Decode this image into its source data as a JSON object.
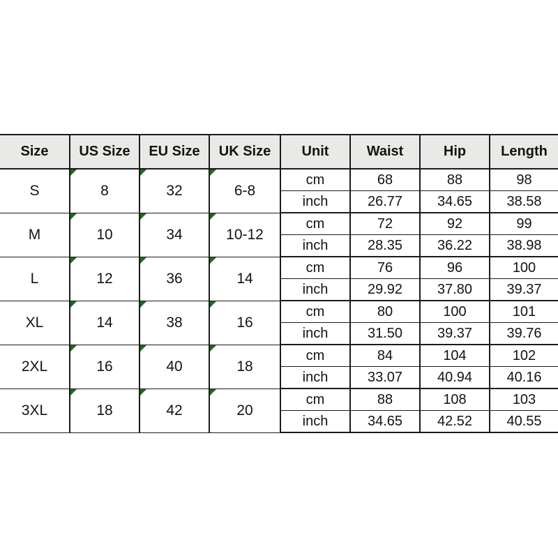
{
  "table": {
    "name": "size-chart",
    "headers": [
      "Size",
      "US Size",
      "EU Size",
      "UK Size",
      "Unit",
      "Waist",
      "Hip",
      "Length"
    ],
    "units": [
      "cm",
      "inch"
    ],
    "marker_icon": "green-corner-triangle-icon",
    "colors": {
      "header_background": "#e9e9e7",
      "cell_background": "#ffffff",
      "border": "#1a1a1a",
      "text": "#16120f",
      "marker": "#1b6b24"
    },
    "rows": [
      {
        "size": "S",
        "us_size": "8",
        "eu_size": "32",
        "uk_size": "6-8",
        "cm": {
          "unit": "cm",
          "waist": "68",
          "hip": "88",
          "length": "98"
        },
        "inch": {
          "unit": "inch",
          "waist": "26.77",
          "hip": "34.65",
          "length": "38.58"
        }
      },
      {
        "size": "M",
        "us_size": "10",
        "eu_size": "34",
        "uk_size": "10-12",
        "cm": {
          "unit": "cm",
          "waist": "72",
          "hip": "92",
          "length": "99"
        },
        "inch": {
          "unit": "inch",
          "waist": "28.35",
          "hip": "36.22",
          "length": "38.98"
        }
      },
      {
        "size": "L",
        "us_size": "12",
        "eu_size": "36",
        "uk_size": "14",
        "cm": {
          "unit": "cm",
          "waist": "76",
          "hip": "96",
          "length": "100"
        },
        "inch": {
          "unit": "inch",
          "waist": "29.92",
          "hip": "37.80",
          "length": "39.37"
        }
      },
      {
        "size": "XL",
        "us_size": "14",
        "eu_size": "38",
        "uk_size": "16",
        "cm": {
          "unit": "cm",
          "waist": "80",
          "hip": "100",
          "length": "101"
        },
        "inch": {
          "unit": "inch",
          "waist": "31.50",
          "hip": "39.37",
          "length": "39.76"
        }
      },
      {
        "size": "2XL",
        "us_size": "16",
        "eu_size": "40",
        "uk_size": "18",
        "cm": {
          "unit": "cm",
          "waist": "84",
          "hip": "104",
          "length": "102"
        },
        "inch": {
          "unit": "inch",
          "waist": "33.07",
          "hip": "40.94",
          "length": "40.16"
        }
      },
      {
        "size": "3XL",
        "us_size": "18",
        "eu_size": "42",
        "uk_size": "20",
        "cm": {
          "unit": "cm",
          "waist": "88",
          "hip": "108",
          "length": "103"
        },
        "inch": {
          "unit": "inch",
          "waist": "34.65",
          "hip": "42.52",
          "length": "40.55"
        }
      }
    ]
  }
}
